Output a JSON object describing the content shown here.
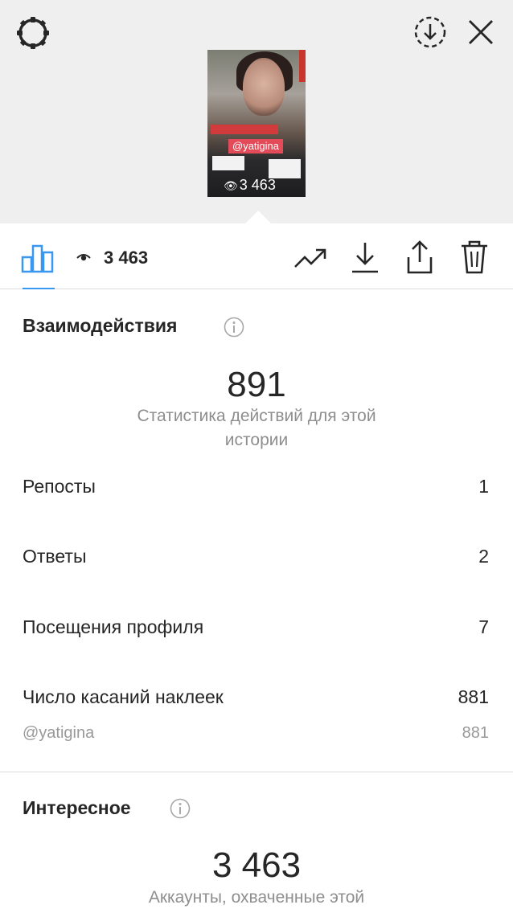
{
  "header": {
    "settings_icon": "gear-icon",
    "download_icon": "download-circle-icon",
    "close_icon": "close-icon"
  },
  "story_preview": {
    "mention_tag": "@yatigina",
    "views": "3 463",
    "brand_color": "#e44b58"
  },
  "toolbar": {
    "views_count": "3 463",
    "icons": [
      "bar-chart-icon",
      "eye-icon",
      "trending-up-icon",
      "download-icon",
      "share-icon",
      "trash-icon"
    ],
    "active_color": "#3897f0"
  },
  "interactions": {
    "title": "Взаимодействия",
    "total": "891",
    "total_caption": "Статистика действий для этой истории",
    "rows": [
      {
        "label": "Репосты",
        "value": "1"
      },
      {
        "label": "Ответы",
        "value": "2"
      },
      {
        "label": "Посещения профиля",
        "value": "7"
      },
      {
        "label": "Число касаний наклеек",
        "value": "881"
      }
    ],
    "sticker_sub": {
      "label": "@yatigina",
      "value": "881"
    }
  },
  "discovery": {
    "title": "Интересное",
    "total": "3 463",
    "total_caption": "Аккаунты, охваченные этой"
  }
}
